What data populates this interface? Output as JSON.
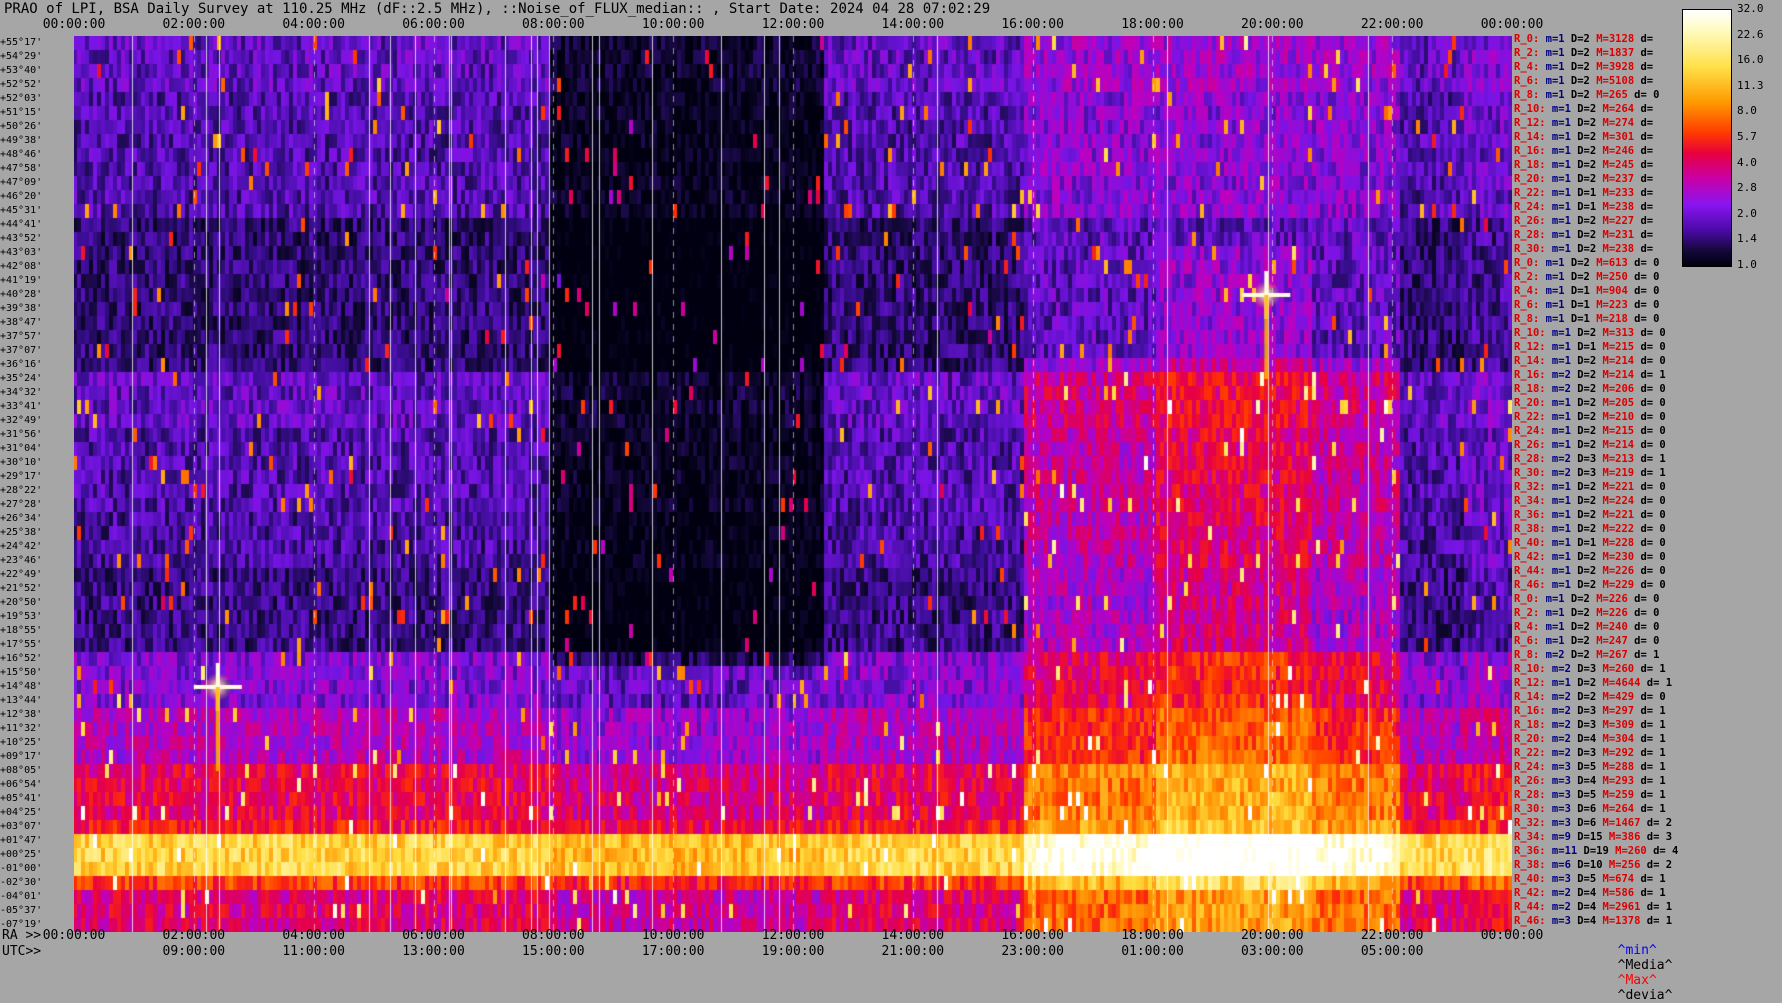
{
  "title": "PRAO of LPI, BSA Daily Survey at 110.25 MHz (dF::2.5 MHz), ::Noise_of_FLUX_median:: , Start Date: 2024 04 28 07:02:29",
  "top_axis_ticks": [
    "00:00:00",
    "02:00:00",
    "04:00:00",
    "06:00:00",
    "08:00:00",
    "10:00:00",
    "12:00:00",
    "14:00:00",
    "16:00:00",
    "18:00:00",
    "20:00:00",
    "22:00:00",
    "00:00:00"
  ],
  "ra_axis_label": "RA >>",
  "ra_axis_ticks": [
    "00:00:00",
    "02:00:00",
    "04:00:00",
    "06:00:00",
    "08:00:00",
    "10:00:00",
    "12:00:00",
    "14:00:00",
    "16:00:00",
    "18:00:00",
    "20:00:00",
    "22:00:00",
    "00:00:00"
  ],
  "utc_axis_label": "UTC>>",
  "utc_axis_ticks": [
    "09:00:00",
    "11:00:00",
    "13:00:00",
    "15:00:00",
    "17:00:00",
    "19:00:00",
    "21:00:00",
    "23:00:00",
    "01:00:00",
    "03:00:00",
    "05:00:00"
  ],
  "declinations": [
    "+55°17'",
    "+54°29'",
    "+53°40'",
    "+52°52'",
    "+52°03'",
    "+51°15'",
    "+50°26'",
    "+49°38'",
    "+48°46'",
    "+47°58'",
    "+47°09'",
    "+46°20'",
    "+45°31'",
    "+44°41'",
    "+43°52'",
    "+43°03'",
    "+42°08'",
    "+41°19'",
    "+40°28'",
    "+39°38'",
    "+38°47'",
    "+37°57'",
    "+37°07'",
    "+36°16'",
    "+35°24'",
    "+34°32'",
    "+33°41'",
    "+32°49'",
    "+31°56'",
    "+31°04'",
    "+30°10'",
    "+29°17'",
    "+28°22'",
    "+27°28'",
    "+26°34'",
    "+25°38'",
    "+24°42'",
    "+23°46'",
    "+22°49'",
    "+21°52'",
    "+20°50'",
    "+19°53'",
    "+18°55'",
    "+17°55'",
    "+16°52'",
    "+15°50'",
    "+14°48'",
    "+13°44'",
    "+12°38'",
    "+11°32'",
    "+10°25'",
    "+09°17'",
    "+08°05'",
    "+06°54'",
    "+05°41'",
    "+04°25'",
    "+03°07'",
    "+01°47'",
    "+00°25'",
    "-01°00'",
    "-02°30'",
    "-04°01'",
    "-05°37'",
    "-07°19'"
  ],
  "right_stats": [
    {
      "r": "R_0:",
      "m": "m=1",
      "d": "D=2",
      "M": "M=3128",
      "dv": "d="
    },
    {
      "r": "R_2:",
      "m": "m=1",
      "d": "D=2",
      "M": "M=1837",
      "dv": "d="
    },
    {
      "r": "R_4:",
      "m": "m=1",
      "d": "D=2",
      "M": "M=3928",
      "dv": "d="
    },
    {
      "r": "R_6:",
      "m": "m=1",
      "d": "D=2",
      "M": "M=5108",
      "dv": "d="
    },
    {
      "r": "R_8:",
      "m": "m=1",
      "d": "D=2",
      "M": "M=265",
      "dv": "d= 0"
    },
    {
      "r": "R_10:",
      "m": "m=1",
      "d": "D=2",
      "M": "M=264",
      "dv": "d="
    },
    {
      "r": "R_12:",
      "m": "m=1",
      "d": "D=2",
      "M": "M=274",
      "dv": "d="
    },
    {
      "r": "R_14:",
      "m": "m=1",
      "d": "D=2",
      "M": "M=301",
      "dv": "d="
    },
    {
      "r": "R_16:",
      "m": "m=1",
      "d": "D=2",
      "M": "M=246",
      "dv": "d="
    },
    {
      "r": "R_18:",
      "m": "m=1",
      "d": "D=2",
      "M": "M=245",
      "dv": "d="
    },
    {
      "r": "R_20:",
      "m": "m=1",
      "d": "D=2",
      "M": "M=237",
      "dv": "d="
    },
    {
      "r": "R_22:",
      "m": "m=1",
      "d": "D=1",
      "M": "M=233",
      "dv": "d="
    },
    {
      "r": "R_24:",
      "m": "m=1",
      "d": "D=1",
      "M": "M=238",
      "dv": "d="
    },
    {
      "r": "R_26:",
      "m": "m=1",
      "d": "D=2",
      "M": "M=227",
      "dv": "d="
    },
    {
      "r": "R_28:",
      "m": "m=1",
      "d": "D=2",
      "M": "M=231",
      "dv": "d="
    },
    {
      "r": "R_30:",
      "m": "m=1",
      "d": "D=2",
      "M": "M=238",
      "dv": "d="
    },
    {
      "r": "R_0:",
      "m": "m=1",
      "d": "D=2",
      "M": "M=613",
      "dv": "d= 0"
    },
    {
      "r": "R_2:",
      "m": "m=1",
      "d": "D=2",
      "M": "M=250",
      "dv": "d= 0"
    },
    {
      "r": "R_4:",
      "m": "m=1",
      "d": "D=1",
      "M": "M=904",
      "dv": "d= 0"
    },
    {
      "r": "R_6:",
      "m": "m=1",
      "d": "D=1",
      "M": "M=223",
      "dv": "d= 0"
    },
    {
      "r": "R_8:",
      "m": "m=1",
      "d": "D=1",
      "M": "M=218",
      "dv": "d= 0"
    },
    {
      "r": "R_10:",
      "m": "m=1",
      "d": "D=2",
      "M": "M=313",
      "dv": "d= 0"
    },
    {
      "r": "R_12:",
      "m": "m=1",
      "d": "D=1",
      "M": "M=215",
      "dv": "d= 0"
    },
    {
      "r": "R_14:",
      "m": "m=1",
      "d": "D=2",
      "M": "M=214",
      "dv": "d= 0"
    },
    {
      "r": "R_16:",
      "m": "m=2",
      "d": "D=2",
      "M": "M=214",
      "dv": "d= 1"
    },
    {
      "r": "R_18:",
      "m": "m=2",
      "d": "D=2",
      "M": "M=206",
      "dv": "d= 0"
    },
    {
      "r": "R_20:",
      "m": "m=1",
      "d": "D=2",
      "M": "M=205",
      "dv": "d= 0"
    },
    {
      "r": "R_22:",
      "m": "m=1",
      "d": "D=2",
      "M": "M=210",
      "dv": "d= 0"
    },
    {
      "r": "R_24:",
      "m": "m=1",
      "d": "D=2",
      "M": "M=215",
      "dv": "d= 0"
    },
    {
      "r": "R_26:",
      "m": "m=1",
      "d": "D=2",
      "M": "M=214",
      "dv": "d= 0"
    },
    {
      "r": "R_28:",
      "m": "m=2",
      "d": "D=3",
      "M": "M=213",
      "dv": "d= 1"
    },
    {
      "r": "R_30:",
      "m": "m=2",
      "d": "D=3",
      "M": "M=219",
      "dv": "d= 1"
    },
    {
      "r": "R_32:",
      "m": "m=1",
      "d": "D=2",
      "M": "M=221",
      "dv": "d= 0"
    },
    {
      "r": "R_34:",
      "m": "m=1",
      "d": "D=2",
      "M": "M=224",
      "dv": "d= 0"
    },
    {
      "r": "R_36:",
      "m": "m=1",
      "d": "D=2",
      "M": "M=221",
      "dv": "d= 0"
    },
    {
      "r": "R_38:",
      "m": "m=1",
      "d": "D=2",
      "M": "M=222",
      "dv": "d= 0"
    },
    {
      "r": "R_40:",
      "m": "m=1",
      "d": "D=1",
      "M": "M=228",
      "dv": "d= 0"
    },
    {
      "r": "R_42:",
      "m": "m=1",
      "d": "D=2",
      "M": "M=230",
      "dv": "d= 0"
    },
    {
      "r": "R_44:",
      "m": "m=1",
      "d": "D=2",
      "M": "M=226",
      "dv": "d= 0"
    },
    {
      "r": "R_46:",
      "m": "m=1",
      "d": "D=2",
      "M": "M=229",
      "dv": "d= 0"
    },
    {
      "r": "R_0:",
      "m": "m=1",
      "d": "D=2",
      "M": "M=226",
      "dv": "d= 0"
    },
    {
      "r": "R_2:",
      "m": "m=1",
      "d": "D=2",
      "M": "M=226",
      "dv": "d= 0"
    },
    {
      "r": "R_4:",
      "m": "m=1",
      "d": "D=2",
      "M": "M=240",
      "dv": "d= 0"
    },
    {
      "r": "R_6:",
      "m": "m=1",
      "d": "D=2",
      "M": "M=247",
      "dv": "d= 0"
    },
    {
      "r": "R_8:",
      "m": "m=2",
      "d": "D=2",
      "M": "M=267",
      "dv": "d= 1"
    },
    {
      "r": "R_10:",
      "m": "m=2",
      "d": "D=3",
      "M": "M=260",
      "dv": "d= 1"
    },
    {
      "r": "R_12:",
      "m": "m=1",
      "d": "D=2",
      "M": "M=4644",
      "dv": "d= 1"
    },
    {
      "r": "R_14:",
      "m": "m=2",
      "d": "D=2",
      "M": "M=429",
      "dv": "d= 0"
    },
    {
      "r": "R_16:",
      "m": "m=2",
      "d": "D=3",
      "M": "M=297",
      "dv": "d= 1"
    },
    {
      "r": "R_18:",
      "m": "m=2",
      "d": "D=3",
      "M": "M=309",
      "dv": "d= 1"
    },
    {
      "r": "R_20:",
      "m": "m=2",
      "d": "D=4",
      "M": "M=304",
      "dv": "d= 1"
    },
    {
      "r": "R_22:",
      "m": "m=2",
      "d": "D=3",
      "M": "M=292",
      "dv": "d= 1"
    },
    {
      "r": "R_24:",
      "m": "m=3",
      "d": "D=5",
      "M": "M=288",
      "dv": "d= 1"
    },
    {
      "r": "R_26:",
      "m": "m=3",
      "d": "D=4",
      "M": "M=293",
      "dv": "d= 1"
    },
    {
      "r": "R_28:",
      "m": "m=3",
      "d": "D=5",
      "M": "M=259",
      "dv": "d= 1"
    },
    {
      "r": "R_30:",
      "m": "m=3",
      "d": "D=6",
      "M": "M=264",
      "dv": "d= 1"
    },
    {
      "r": "R_32:",
      "m": "m=3",
      "d": "D=6",
      "M": "M=1467",
      "dv": "d= 2"
    },
    {
      "r": "R_34:",
      "m": "m=9",
      "d": "D=15",
      "M": "M=386",
      "dv": "d= 3"
    },
    {
      "r": "R_36:",
      "m": "m=11",
      "d": "D=19",
      "M": "M=260",
      "dv": "d= 4"
    },
    {
      "r": "R_38:",
      "m": "m=6",
      "d": "D=10",
      "M": "M=256",
      "dv": "d= 2"
    },
    {
      "r": "R_40:",
      "m": "m=3",
      "d": "D=5",
      "M": "M=674",
      "dv": "d= 1"
    },
    {
      "r": "R_42:",
      "m": "m=2",
      "d": "D=4",
      "M": "M=586",
      "dv": "d= 1"
    },
    {
      "r": "R_44:",
      "m": "m=2",
      "d": "D=4",
      "M": "M=2961",
      "dv": "d= 1"
    },
    {
      "r": "R_46:",
      "m": "m=3",
      "d": "D=4",
      "M": "M=1378",
      "dv": "d= 1"
    }
  ],
  "legend_bottom": {
    "min": "^min^",
    "median": "^Media^",
    "max": "^Max^",
    "dev": "^devia^"
  },
  "colorbar": {
    "ticks": [
      "32.0",
      "22.6",
      "16.0",
      "11.3",
      "8.0",
      "5.7",
      "4.0",
      "2.8",
      "2.0",
      "1.4",
      "1.0"
    ]
  },
  "chart_data": {
    "type": "heatmap",
    "title": "PRAO of LPI, BSA Daily Survey at 110.25 MHz (dF::2.5 MHz), ::Noise_of_FLUX_median:: , Start Date: 2024 04 28 07:02:29",
    "x_ticks_ra": [
      "00:00:00",
      "02:00:00",
      "04:00:00",
      "06:00:00",
      "08:00:00",
      "10:00:00",
      "12:00:00",
      "14:00:00",
      "16:00:00",
      "18:00:00",
      "20:00:00",
      "22:00:00",
      "00:00:00"
    ],
    "x_ticks_utc": [
      "09:00:00",
      "11:00:00",
      "13:00:00",
      "15:00:00",
      "17:00:00",
      "19:00:00",
      "21:00:00",
      "23:00:00",
      "01:00:00",
      "03:00:00",
      "05:00:00"
    ],
    "colorbar_range": [
      1.0,
      32.0
    ],
    "colorbar_scale": "log2",
    "rows": 64,
    "bright_band_declination": "+00°25'",
    "bright_sources": [
      {
        "ra_hours": 2.4,
        "dec": "+14°48'"
      },
      {
        "ra_hours": 19.9,
        "dec": "+40°28'"
      }
    ]
  }
}
